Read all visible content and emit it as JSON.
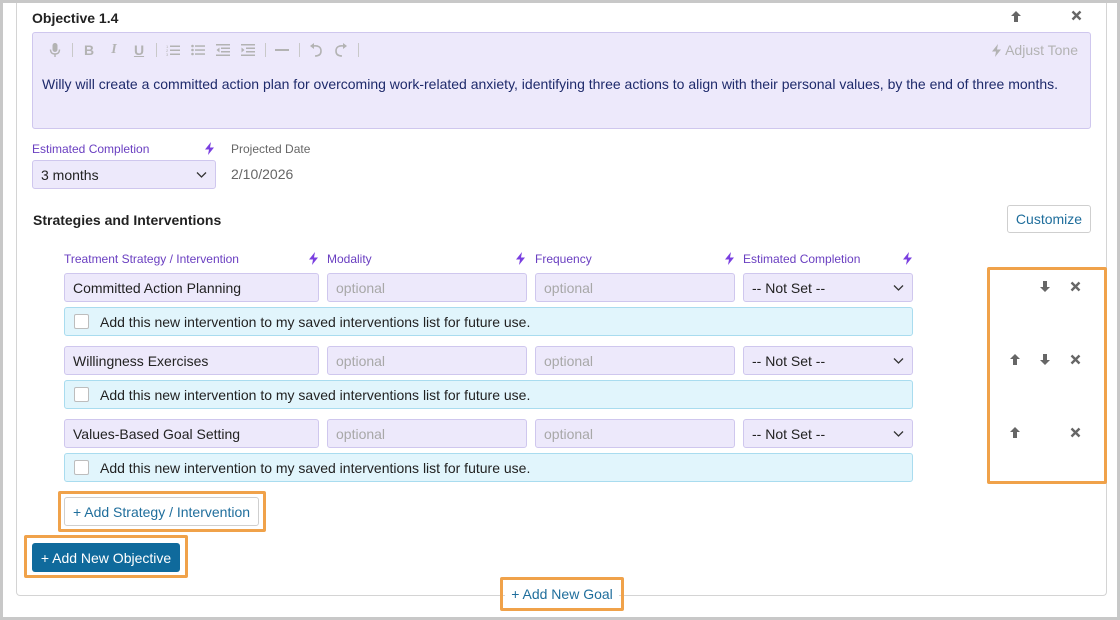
{
  "objective": {
    "title": "Objective 1.4",
    "text": "Willy will create a committed action plan for overcoming work-related anxiety, identifying three actions to align with their personal values, by the end of three months.",
    "adjust_tone_label": "Adjust Tone",
    "estimated_completion_label": "Estimated Completion",
    "estimated_completion_value": "3 months",
    "projected_date_label": "Projected Date",
    "projected_date_value": "2/10/2026"
  },
  "toolbar": {
    "icons": [
      "microphone-icon",
      "bold-icon",
      "italic-icon",
      "underline-icon",
      "numbered-list-icon",
      "bullet-list-icon",
      "outdent-icon",
      "indent-icon",
      "horizontal-rule-icon",
      "undo-icon",
      "redo-icon"
    ]
  },
  "strategies": {
    "title": "Strategies and Interventions",
    "customize_label": "Customize",
    "columns": {
      "strategy": "Treatment Strategy / Intervention",
      "modality": "Modality",
      "frequency": "Frequency",
      "completion": "Estimated Completion"
    },
    "rows": [
      {
        "name": "Committed Action Planning",
        "modality": "optional",
        "frequency": "optional",
        "completion": "-- Not Set --",
        "save_text": "Add this new intervention to my saved interventions list for future use."
      },
      {
        "name": "Willingness Exercises",
        "modality": "optional",
        "frequency": "optional",
        "completion": "-- Not Set --",
        "save_text": "Add this new intervention to my saved interventions list for future use."
      },
      {
        "name": "Values-Based Goal Setting",
        "modality": "optional",
        "frequency": "optional",
        "completion": "-- Not Set --",
        "save_text": "Add this new intervention to my saved interventions list for future use."
      }
    ],
    "add_label": "+ Add Strategy / Intervention"
  },
  "actions": {
    "add_objective_label": "+ Add New Objective",
    "add_goal_label": "+ Add New Goal"
  },
  "colors": {
    "accent_purple": "#6a3fc1",
    "field_bg": "#ede9fb",
    "primary_blue": "#0f6a9c",
    "highlight_orange": "#f0a24a",
    "info_bg": "#e1f5fc"
  }
}
